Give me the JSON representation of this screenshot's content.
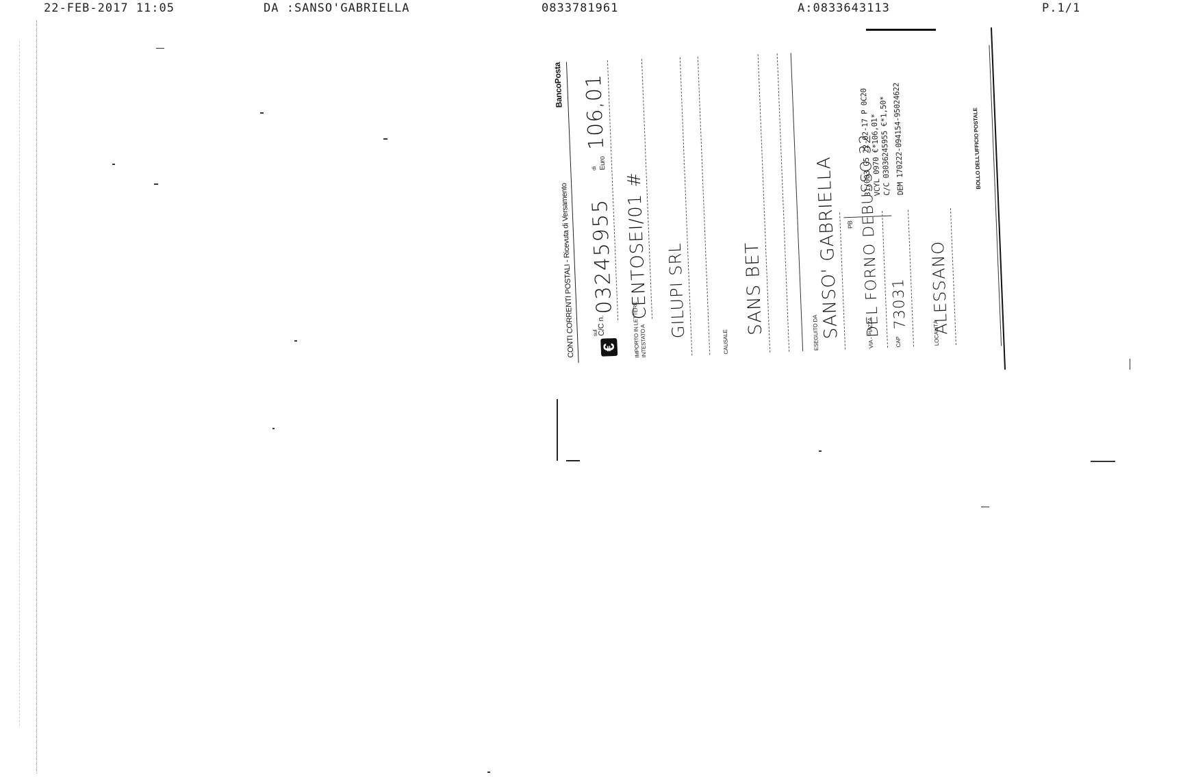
{
  "fax_header": {
    "datetime": "22-FEB-2017 11:05",
    "from": "DA :SANSO'GABRIELLA",
    "from_number": "0833781961",
    "to": "A:0833643113",
    "page": "P.1/1"
  },
  "receipt": {
    "brand": "BancoPosta",
    "title": "CONTI CORRENTI POSTALI - Ricevuta di Versamento",
    "currency_symbol": "€",
    "sul_label": "sul",
    "cc_label": "C/C n.",
    "di_label": "di",
    "euro_label": "Euro",
    "account_number": "03245955",
    "amount": "106,01",
    "importo_label": "IMPORTO IN LETTERE",
    "intestato_label": "INTESTATO A",
    "amount_words": "CENTOSEI/01 #",
    "holder": "GILUPI SRL",
    "causale_label": "CAUSALE",
    "causale": "SANS BET",
    "eseguito_label": "ESEGUITO DA",
    "payer": "SANSO' GABRIELLA",
    "via_label": "VIA - PIAZZA",
    "street": "DEL FORNO DEBUSSO 32",
    "cap_label": "CAP",
    "cap": "73031",
    "pb_label": "PB",
    "localita_label": "LOCALITÀ",
    "town": "ALESSANO",
    "stamp_lines": [
      "31/003  G5  22-02-17  P  0C20",
      "VCYL 0970          €*106,01*",
      "C/C 03036245955    €*1,50*",
      "DEM 170222-094154-95024622"
    ],
    "bollo": "BOLLO DELL'UFFICIO POSTALE"
  }
}
